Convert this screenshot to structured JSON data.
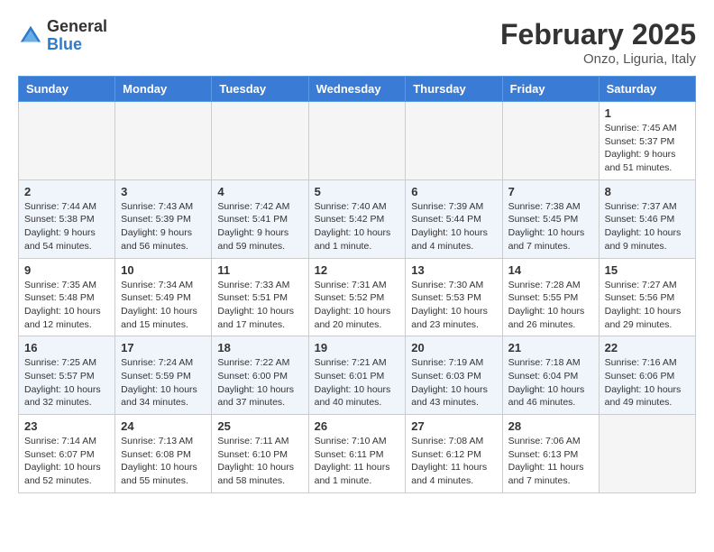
{
  "logo": {
    "general": "General",
    "blue": "Blue"
  },
  "title": "February 2025",
  "location": "Onzo, Liguria, Italy",
  "weekdays": [
    "Sunday",
    "Monday",
    "Tuesday",
    "Wednesday",
    "Thursday",
    "Friday",
    "Saturday"
  ],
  "weeks": [
    [
      {
        "day": "",
        "info": ""
      },
      {
        "day": "",
        "info": ""
      },
      {
        "day": "",
        "info": ""
      },
      {
        "day": "",
        "info": ""
      },
      {
        "day": "",
        "info": ""
      },
      {
        "day": "",
        "info": ""
      },
      {
        "day": "1",
        "info": "Sunrise: 7:45 AM\nSunset: 5:37 PM\nDaylight: 9 hours and 51 minutes."
      }
    ],
    [
      {
        "day": "2",
        "info": "Sunrise: 7:44 AM\nSunset: 5:38 PM\nDaylight: 9 hours and 54 minutes."
      },
      {
        "day": "3",
        "info": "Sunrise: 7:43 AM\nSunset: 5:39 PM\nDaylight: 9 hours and 56 minutes."
      },
      {
        "day": "4",
        "info": "Sunrise: 7:42 AM\nSunset: 5:41 PM\nDaylight: 9 hours and 59 minutes."
      },
      {
        "day": "5",
        "info": "Sunrise: 7:40 AM\nSunset: 5:42 PM\nDaylight: 10 hours and 1 minute."
      },
      {
        "day": "6",
        "info": "Sunrise: 7:39 AM\nSunset: 5:44 PM\nDaylight: 10 hours and 4 minutes."
      },
      {
        "day": "7",
        "info": "Sunrise: 7:38 AM\nSunset: 5:45 PM\nDaylight: 10 hours and 7 minutes."
      },
      {
        "day": "8",
        "info": "Sunrise: 7:37 AM\nSunset: 5:46 PM\nDaylight: 10 hours and 9 minutes."
      }
    ],
    [
      {
        "day": "9",
        "info": "Sunrise: 7:35 AM\nSunset: 5:48 PM\nDaylight: 10 hours and 12 minutes."
      },
      {
        "day": "10",
        "info": "Sunrise: 7:34 AM\nSunset: 5:49 PM\nDaylight: 10 hours and 15 minutes."
      },
      {
        "day": "11",
        "info": "Sunrise: 7:33 AM\nSunset: 5:51 PM\nDaylight: 10 hours and 17 minutes."
      },
      {
        "day": "12",
        "info": "Sunrise: 7:31 AM\nSunset: 5:52 PM\nDaylight: 10 hours and 20 minutes."
      },
      {
        "day": "13",
        "info": "Sunrise: 7:30 AM\nSunset: 5:53 PM\nDaylight: 10 hours and 23 minutes."
      },
      {
        "day": "14",
        "info": "Sunrise: 7:28 AM\nSunset: 5:55 PM\nDaylight: 10 hours and 26 minutes."
      },
      {
        "day": "15",
        "info": "Sunrise: 7:27 AM\nSunset: 5:56 PM\nDaylight: 10 hours and 29 minutes."
      }
    ],
    [
      {
        "day": "16",
        "info": "Sunrise: 7:25 AM\nSunset: 5:57 PM\nDaylight: 10 hours and 32 minutes."
      },
      {
        "day": "17",
        "info": "Sunrise: 7:24 AM\nSunset: 5:59 PM\nDaylight: 10 hours and 34 minutes."
      },
      {
        "day": "18",
        "info": "Sunrise: 7:22 AM\nSunset: 6:00 PM\nDaylight: 10 hours and 37 minutes."
      },
      {
        "day": "19",
        "info": "Sunrise: 7:21 AM\nSunset: 6:01 PM\nDaylight: 10 hours and 40 minutes."
      },
      {
        "day": "20",
        "info": "Sunrise: 7:19 AM\nSunset: 6:03 PM\nDaylight: 10 hours and 43 minutes."
      },
      {
        "day": "21",
        "info": "Sunrise: 7:18 AM\nSunset: 6:04 PM\nDaylight: 10 hours and 46 minutes."
      },
      {
        "day": "22",
        "info": "Sunrise: 7:16 AM\nSunset: 6:06 PM\nDaylight: 10 hours and 49 minutes."
      }
    ],
    [
      {
        "day": "23",
        "info": "Sunrise: 7:14 AM\nSunset: 6:07 PM\nDaylight: 10 hours and 52 minutes."
      },
      {
        "day": "24",
        "info": "Sunrise: 7:13 AM\nSunset: 6:08 PM\nDaylight: 10 hours and 55 minutes."
      },
      {
        "day": "25",
        "info": "Sunrise: 7:11 AM\nSunset: 6:10 PM\nDaylight: 10 hours and 58 minutes."
      },
      {
        "day": "26",
        "info": "Sunrise: 7:10 AM\nSunset: 6:11 PM\nDaylight: 11 hours and 1 minute."
      },
      {
        "day": "27",
        "info": "Sunrise: 7:08 AM\nSunset: 6:12 PM\nDaylight: 11 hours and 4 minutes."
      },
      {
        "day": "28",
        "info": "Sunrise: 7:06 AM\nSunset: 6:13 PM\nDaylight: 11 hours and 7 minutes."
      },
      {
        "day": "",
        "info": ""
      }
    ]
  ]
}
